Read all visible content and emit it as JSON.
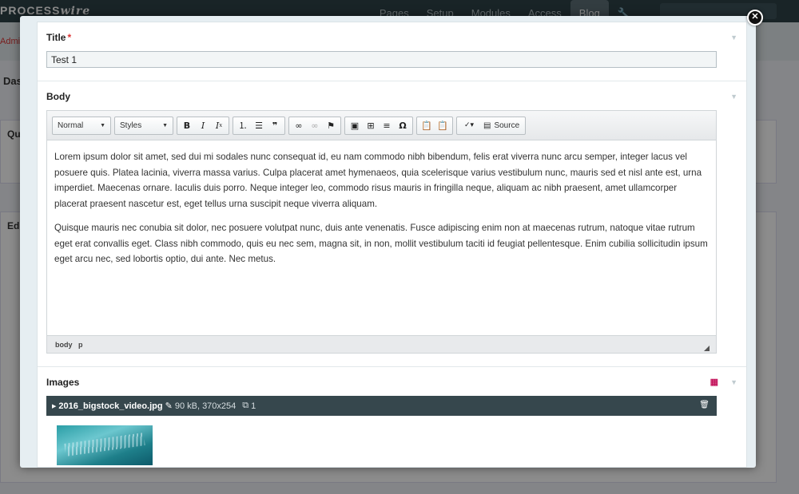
{
  "background": {
    "logo_text": "PROCESS",
    "logo_italic": "wire",
    "nav": [
      "Pages",
      "Setup",
      "Modules",
      "Access",
      "Blog"
    ],
    "active_nav": "Blog",
    "breadcrumb": "Admi",
    "dashboard_label": "Das",
    "card_labels": [
      "Qu",
      "Ed"
    ]
  },
  "modal": {
    "close_icon": "close-icon",
    "title_field": {
      "label": "Title",
      "required_mark": "*",
      "value": "Test 1"
    },
    "body_field": {
      "label": "Body",
      "format_select": "Normal",
      "styles_select": "Styles",
      "source_label": "Source",
      "paragraphs": [
        "Lorem ipsum dolor sit amet, sed dui mi sodales nunc consequat id, eu nam commodo nibh bibendum, felis erat viverra nunc arcu semper, integer lacus vel posuere quis. Platea lacinia, viverra massa varius. Culpa placerat amet hymenaeos, quia scelerisque varius vestibulum nunc, mauris sed et nisl ante est, urna imperdiet. Maecenas ornare. Iaculis duis porro. Neque integer leo, commodo risus mauris in fringilla neque, aliquam ac nibh praesent, amet ullamcorper placerat praesent nascetur est, eget tellus urna suscipit neque viverra aliquam.",
        "Quisque mauris nec conubia sit dolor, nec posuere volutpat nunc, duis ante venenatis. Fusce adipiscing enim non at maecenas rutrum, natoque vitae rutrum eget erat convallis eget. Class nibh commodo, quis eu nec sem, magna sit, in non, mollit vestibulum taciti id feugiat pellentesque. Enim cubilia sollicitudin ipsum eget arcu nec, sed lobortis optio, dui ante. Nec metus."
      ],
      "path": [
        "body",
        "p"
      ]
    },
    "images_field": {
      "label": "Images",
      "file": {
        "name": "2016_bigstock_video.jpg",
        "size_dims": "90 kB, 370x254",
        "count": "1"
      }
    }
  },
  "colors": {
    "header_dark": "#2f4248",
    "image_bar": "#36474d",
    "required": "#dd3333",
    "accent_pink": "#c4145c"
  }
}
